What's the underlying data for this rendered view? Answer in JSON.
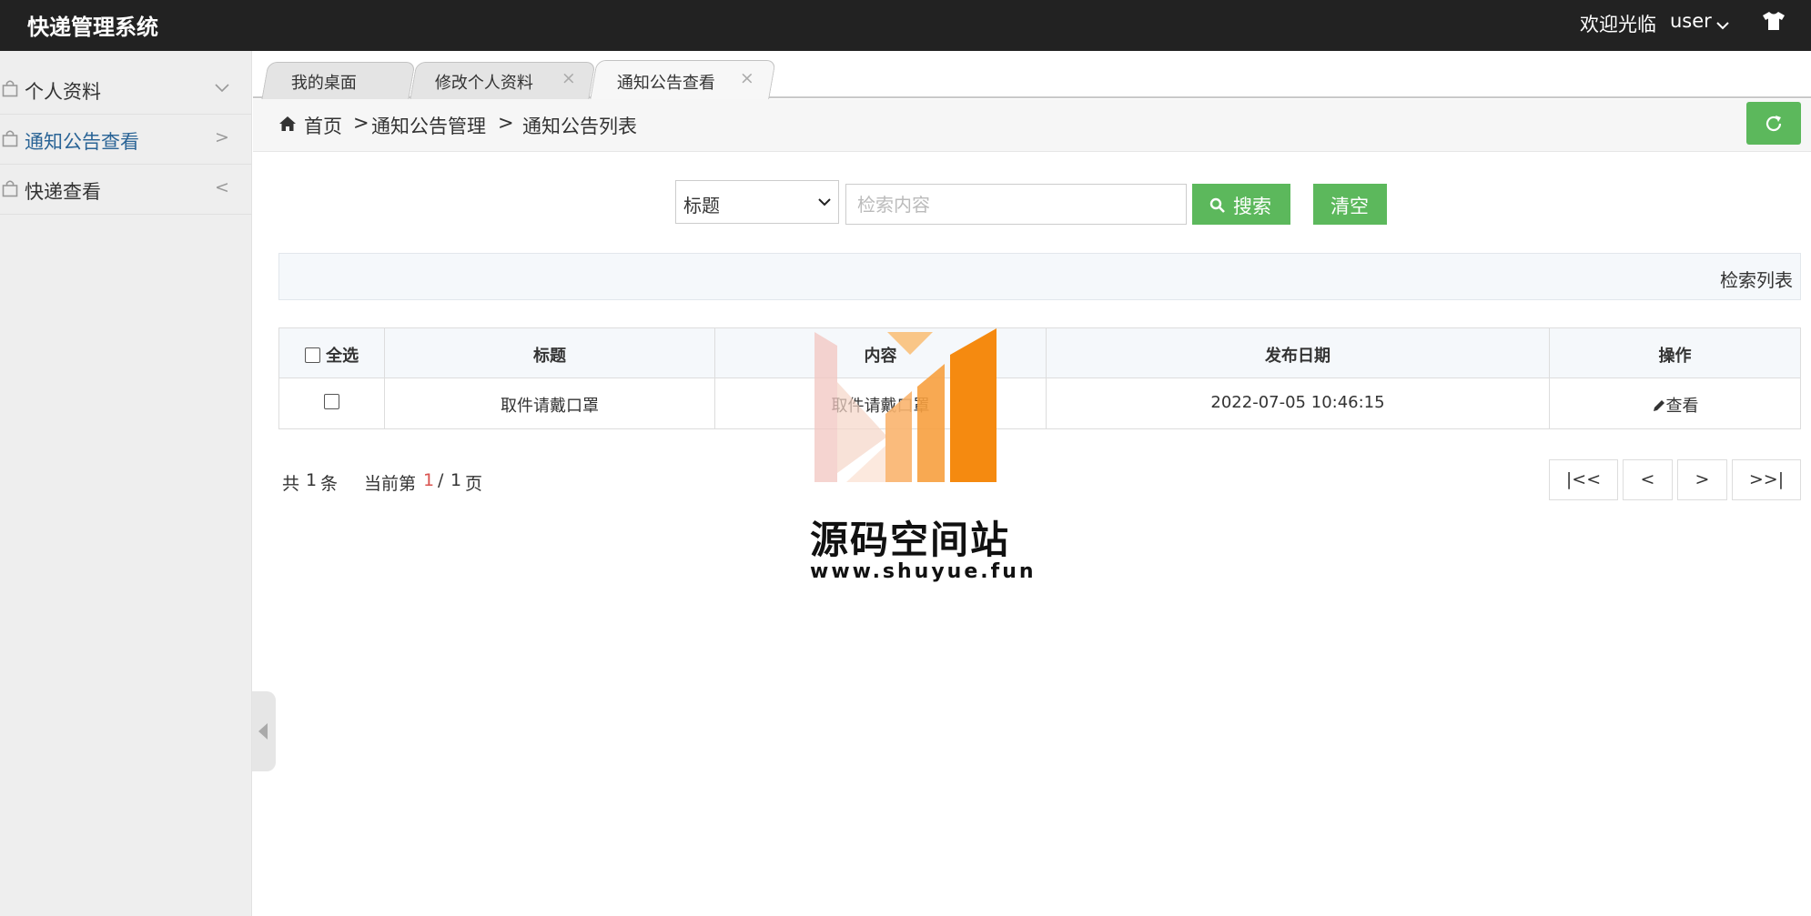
{
  "header": {
    "app_title": "快递管理系统",
    "welcome": "欢迎光临",
    "username": "user"
  },
  "sidebar": {
    "items": [
      {
        "label": "个人资料",
        "arrow": "∨",
        "active": false
      },
      {
        "label": "通知公告查看",
        "arrow": ">",
        "active": true
      },
      {
        "label": "快递查看",
        "arrow": "<",
        "active": false
      }
    ]
  },
  "tabs": [
    {
      "label": "我的桌面",
      "closable": false,
      "active": false
    },
    {
      "label": "修改个人资料",
      "closable": true,
      "active": false
    },
    {
      "label": "通知公告查看",
      "closable": true,
      "active": true
    }
  ],
  "breadcrumb": {
    "home": "首页",
    "sep": ">",
    "level1": "通知公告管理",
    "level2": "通知公告列表"
  },
  "search": {
    "field_selected": "标题",
    "placeholder": "检索内容",
    "search_label": "搜索",
    "clear_label": "清空"
  },
  "panel": {
    "title": "检索列表"
  },
  "table": {
    "select_all_label": "全选",
    "columns": [
      "标题",
      "内容",
      "发布日期",
      "操作"
    ],
    "rows": [
      {
        "title": "取件请戴口罩",
        "content": "取件请戴口罩",
        "date": "2022-07-05 10:46:15",
        "action": "查看"
      }
    ]
  },
  "pagination": {
    "total_prefix": "共",
    "total": "1",
    "total_suffix": "条",
    "current_prefix": "当前第",
    "current": "1",
    "slash": "/",
    "pages": "1",
    "pages_suffix": "页",
    "first": "|<<",
    "prev": "<",
    "next": ">",
    "last": ">>|"
  },
  "watermark": {
    "name": "源码空间站",
    "url": "www.shuyue.fun"
  },
  "colors": {
    "topbar": "#222222",
    "accent_green": "#5cb85c",
    "active_link": "#2a6496",
    "current_page": "#d9534f"
  }
}
